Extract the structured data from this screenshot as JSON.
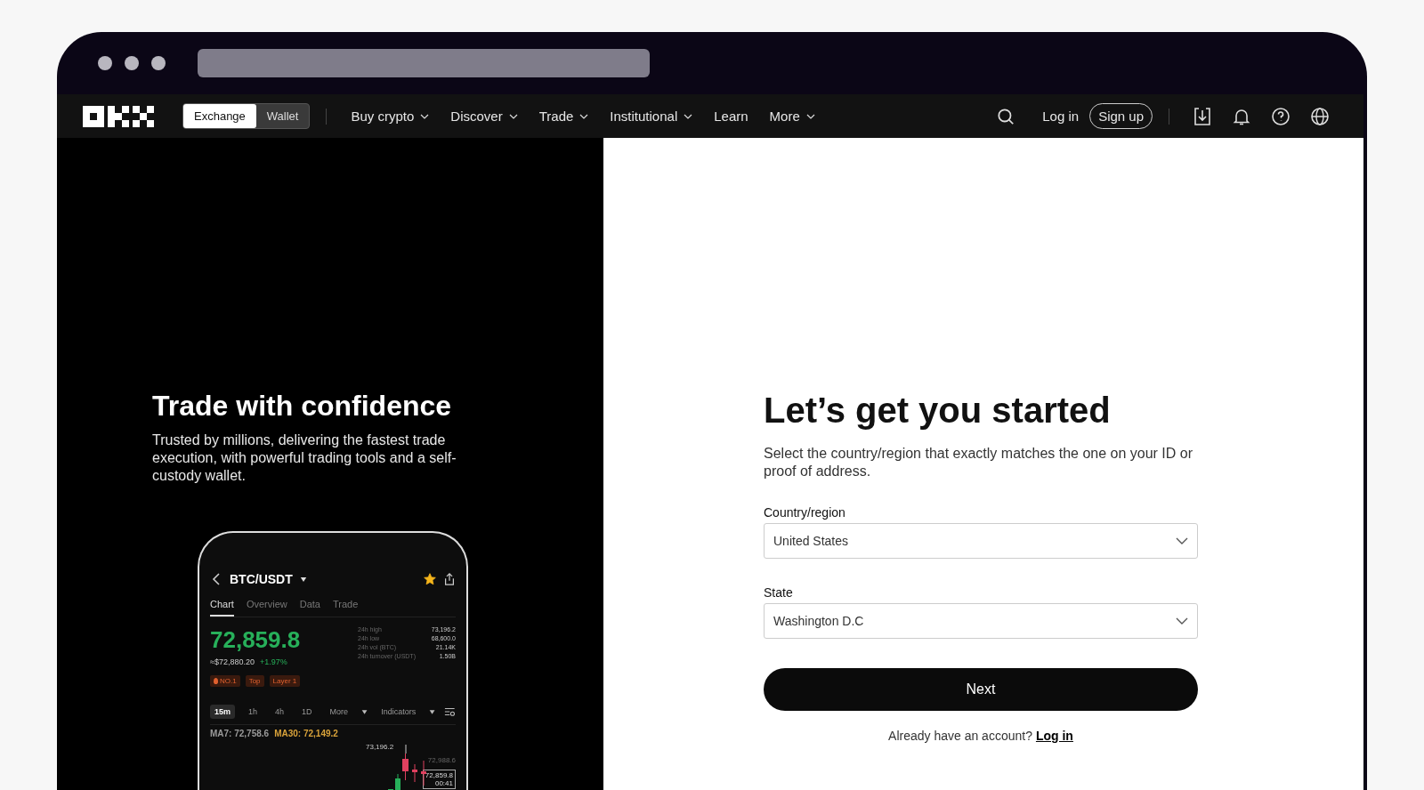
{
  "nav": {
    "toggle": [
      {
        "label": "Exchange",
        "selected": true
      },
      {
        "label": "Wallet",
        "selected": false
      }
    ],
    "menu": [
      {
        "label": "Buy crypto",
        "has_menu": true
      },
      {
        "label": "Discover",
        "has_menu": true
      },
      {
        "label": "Trade",
        "has_menu": true
      },
      {
        "label": "Institutional",
        "has_menu": true
      },
      {
        "label": "Learn",
        "has_menu": false
      },
      {
        "label": "More",
        "has_menu": true
      }
    ],
    "login": "Log in",
    "signup": "Sign up"
  },
  "hero": {
    "title": "Trade with confidence",
    "text": "Trusted by millions, delivering the fastest trade execution, with powerful trading tools and a self-custody wallet."
  },
  "phone": {
    "pair": "BTC/USDT",
    "favorite": true,
    "tabs": [
      {
        "label": "Chart",
        "selected": true
      },
      {
        "label": "Overview",
        "selected": false
      },
      {
        "label": "Data",
        "selected": false
      },
      {
        "label": "Trade",
        "selected": false
      }
    ],
    "price": "72,859.8",
    "fiat": "≈$72,880.20",
    "change": "+1.97%",
    "tags": [
      {
        "label": "NO.1",
        "kind": "rank"
      },
      {
        "label": "Top",
        "kind": "tag"
      },
      {
        "label": "Layer 1",
        "kind": "tag"
      }
    ],
    "stats": [
      {
        "label": "24h high",
        "value": "73,196.2"
      },
      {
        "label": "24h low",
        "value": "68,600.0"
      },
      {
        "label": "24h vol (BTC)",
        "value": "21.14K"
      },
      {
        "label": "24h turnover (USDT)",
        "value": "1.50B"
      }
    ],
    "intervals": [
      {
        "label": "15m",
        "selected": true
      },
      {
        "label": "1h",
        "selected": false
      },
      {
        "label": "4h",
        "selected": false
      },
      {
        "label": "1D",
        "selected": false
      }
    ],
    "more": "More",
    "indicators": "Indicators",
    "ma": [
      {
        "label": "MA7: 72,758.6",
        "color": "#9a9a9a"
      },
      {
        "label": "MA30: 72,149.2",
        "color": "#d8a23a"
      }
    ],
    "high_label": "73,196.2",
    "axis_label": "72,988.6",
    "last_price": "72,859.8",
    "countdown": "00:41"
  },
  "form": {
    "title": "Let’s get you started",
    "subtitle": "Select the country/region that exactly matches the one on your ID or proof of address.",
    "fields": [
      {
        "label": "Country/region",
        "value": "United States"
      },
      {
        "label": "State",
        "value": "Washington D.C"
      }
    ],
    "button": "Next",
    "prompt": "Already have an account?",
    "link": "Log in"
  }
}
